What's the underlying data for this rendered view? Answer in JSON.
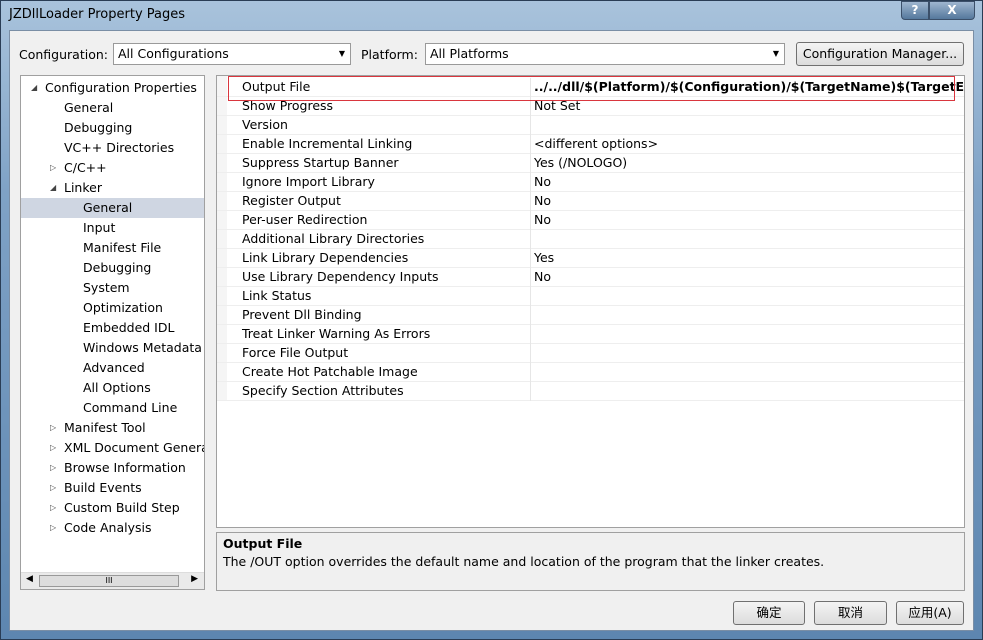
{
  "window": {
    "title": "JZDllLoader Property Pages",
    "help": "?",
    "close": "X"
  },
  "toolbar": {
    "configuration_label": "Configuration:",
    "configuration_value": "All Configurations",
    "platform_label": "Platform:",
    "platform_value": "All Platforms",
    "config_manager": "Configuration Manager..."
  },
  "tree": {
    "items": [
      {
        "label": "Configuration Properties",
        "level": 0,
        "expander": "expanded"
      },
      {
        "label": "General",
        "level": 1
      },
      {
        "label": "Debugging",
        "level": 1
      },
      {
        "label": "VC++ Directories",
        "level": 1
      },
      {
        "label": "C/C++",
        "level": 1,
        "expander": "collapsed"
      },
      {
        "label": "Linker",
        "level": 1,
        "expander": "expanded"
      },
      {
        "label": "General",
        "level": 2,
        "selected": true
      },
      {
        "label": "Input",
        "level": 2
      },
      {
        "label": "Manifest File",
        "level": 2
      },
      {
        "label": "Debugging",
        "level": 2
      },
      {
        "label": "System",
        "level": 2
      },
      {
        "label": "Optimization",
        "level": 2
      },
      {
        "label": "Embedded IDL",
        "level": 2
      },
      {
        "label": "Windows Metadata",
        "level": 2
      },
      {
        "label": "Advanced",
        "level": 2
      },
      {
        "label": "All Options",
        "level": 2
      },
      {
        "label": "Command Line",
        "level": 2
      },
      {
        "label": "Manifest Tool",
        "level": 1,
        "expander": "collapsed"
      },
      {
        "label": "XML Document Generat",
        "level": 1,
        "expander": "collapsed"
      },
      {
        "label": "Browse Information",
        "level": 1,
        "expander": "collapsed"
      },
      {
        "label": "Build Events",
        "level": 1,
        "expander": "collapsed"
      },
      {
        "label": "Custom Build Step",
        "level": 1,
        "expander": "collapsed"
      },
      {
        "label": "Code Analysis",
        "level": 1,
        "expander": "collapsed"
      }
    ],
    "scroll_thumb": "III"
  },
  "grid": {
    "rows": [
      {
        "name": "Output File",
        "value": "../../dll/$(Platform)/$(Configuration)/$(TargetName)$(TargetExt)",
        "bold": true
      },
      {
        "name": "Show Progress",
        "value": "Not Set"
      },
      {
        "name": "Version",
        "value": ""
      },
      {
        "name": "Enable Incremental Linking",
        "value": "<different options>"
      },
      {
        "name": "Suppress Startup Banner",
        "value": "Yes (/NOLOGO)"
      },
      {
        "name": "Ignore Import Library",
        "value": "No"
      },
      {
        "name": "Register Output",
        "value": "No"
      },
      {
        "name": "Per-user Redirection",
        "value": "No"
      },
      {
        "name": "Additional Library Directories",
        "value": ""
      },
      {
        "name": "Link Library Dependencies",
        "value": "Yes"
      },
      {
        "name": "Use Library Dependency Inputs",
        "value": "No"
      },
      {
        "name": "Link Status",
        "value": ""
      },
      {
        "name": "Prevent Dll Binding",
        "value": ""
      },
      {
        "name": "Treat Linker Warning As Errors",
        "value": ""
      },
      {
        "name": "Force File Output",
        "value": ""
      },
      {
        "name": "Create Hot Patchable Image",
        "value": ""
      },
      {
        "name": "Specify Section Attributes",
        "value": ""
      }
    ]
  },
  "description": {
    "title": "Output File",
    "text": "The /OUT option overrides the default name and location of the program that the linker creates."
  },
  "buttons": {
    "ok": "确定",
    "cancel": "取消",
    "apply": "应用(A)"
  },
  "colors": {
    "highlight_border": "#d9363e",
    "selection": "#cfd6e2"
  }
}
